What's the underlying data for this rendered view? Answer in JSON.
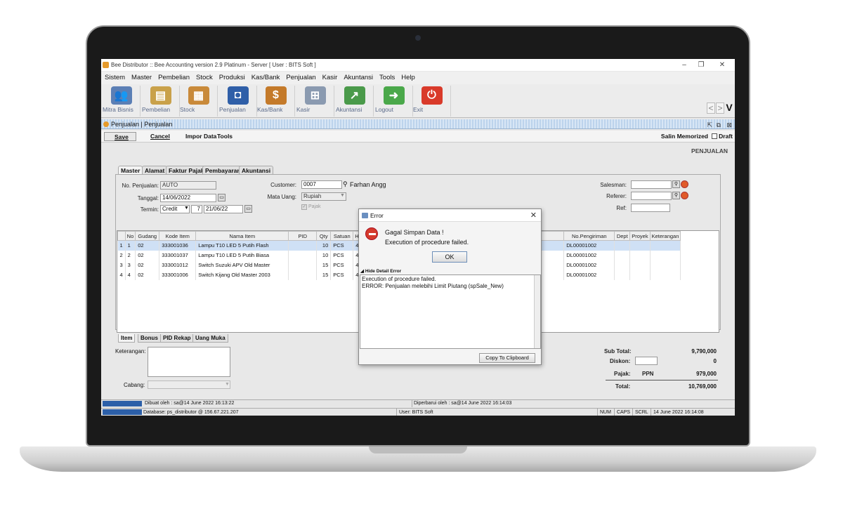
{
  "window": {
    "title": "Bee Distributor :: Bee Accounting version 2.9 Platinum - Server  [ User : BITS Soft ]",
    "minimize": "–",
    "restore": "❐",
    "close": "✕"
  },
  "menu": [
    "Sistem",
    "Master",
    "Pembelian",
    "Stock",
    "Produksi",
    "Kas/Bank",
    "Penjualan",
    "Kasir",
    "Akuntansi",
    "Tools",
    "Help"
  ],
  "toolbar": [
    {
      "label": "Mitra Bisnis",
      "icon": "users-icon",
      "color": "#5b7fb5"
    },
    {
      "label": "Pembelian",
      "icon": "documents-icon",
      "color": "#c9a14a"
    },
    {
      "label": "Stock",
      "icon": "boxes-icon",
      "color": "#c98a3a"
    },
    {
      "label": "Penjualan",
      "icon": "shopping-bag-icon",
      "color": "#2f5fa8"
    },
    {
      "label": "Kas/Bank",
      "icon": "money-bag-icon",
      "color": "#c47a2a"
    },
    {
      "label": "Kasir",
      "icon": "cart-icon",
      "color": "#8a9ab0"
    },
    {
      "label": "Akuntansi",
      "icon": "chart-icon",
      "color": "#4a9a4a"
    },
    {
      "label": "Logout",
      "icon": "logout-icon",
      "color": "#4aa84a"
    },
    {
      "label": "Exit",
      "icon": "power-icon",
      "color": "#d93a2a"
    }
  ],
  "nav": {
    "prev": "<",
    "next": ">",
    "logo": "V"
  },
  "form_title": "Penjualan | Penjualan",
  "actions": {
    "save": "Save",
    "cancel": "Cancel",
    "impor": "Impor Data",
    "tools": "Tools",
    "salin": "Salin Memorized",
    "draft": "Draft"
  },
  "heading": "PENJUALAN",
  "tabs": [
    "Master",
    "Alamat",
    "Faktur Pajak",
    "Pembayaran",
    "Akuntansi"
  ],
  "fields": {
    "no_penjualan_label": "No. Penjualan:",
    "no_penjualan": "AUTO",
    "tanggal_label": "Tanggal:",
    "tanggal": "14/06/2022",
    "termin_label": "Termin:",
    "termin": "Credit",
    "termin_days": "7",
    "termin_date": "21/06/22",
    "customer_label": "Customer:",
    "customer_code": "0007",
    "customer_name": "Farhan Angg",
    "mata_uang_label": "Mata Uang:",
    "mata_uang": "Rupiah",
    "pajak_label": "Pajak",
    "salesman_label": "Salesman:",
    "referer_label": "Referer:",
    "ref_label": "Ref:"
  },
  "grid": {
    "headers": [
      "No",
      "Gudang",
      "Kode Item",
      "Nama Item",
      "PID",
      "Qty",
      "Satuan",
      "H",
      "SO",
      "No.Pengiriman",
      "Dept",
      "Proyek",
      "Keterangan"
    ],
    "rows": [
      {
        "idx": "1",
        "no": "1",
        "gudang": "02",
        "kode": "333001036",
        "nama": "Lampu T10 LED 5 Putih Flash",
        "qty": "10",
        "satuan": "PCS",
        "h": "4",
        "pengiriman": "DL00001002"
      },
      {
        "idx": "2",
        "no": "2",
        "gudang": "02",
        "kode": "333001037",
        "nama": "Lampu T10 LED 5 Putih Biasa",
        "qty": "10",
        "satuan": "PCS",
        "h": "4",
        "pengiriman": "DL00001002"
      },
      {
        "idx": "3",
        "no": "3",
        "gudang": "02",
        "kode": "333001012",
        "nama": "Switch Suzuki APV Old Master",
        "qty": "15",
        "satuan": "PCS",
        "h": "4",
        "pengiriman": "DL00001002"
      },
      {
        "idx": "4",
        "no": "4",
        "gudang": "02",
        "kode": "333001006",
        "nama": "Switch Kijang Old Master 2003",
        "qty": "15",
        "satuan": "PCS",
        "h": "4",
        "pengiriman": "DL00001002"
      }
    ]
  },
  "bottom_tabs": [
    "Item",
    "Bonus",
    "PID Rekap",
    "Uang Muka"
  ],
  "bottom": {
    "keterangan_label": "Keterangan:",
    "cabang_label": "Cabang:"
  },
  "totals": {
    "subtotal_label": "Sub Total:",
    "subtotal": "9,790,000",
    "diskon_label": "Diskon:",
    "diskon": "0",
    "pajak_label": "Pajak:",
    "pajak_type": "PPN",
    "pajak": "979,000",
    "total_label": "Total:",
    "total": "10,769,000"
  },
  "status": {
    "dibuat": "Dibuat oleh : sa@14 June 2022  16:13:22",
    "diperbarui": "Diperbarui oleh : sa@14 June 2022  16:14:03",
    "database": "Database: ps_distributor @ 156.67.221.207",
    "user": "User: BITS Soft",
    "num": "NUM",
    "caps": "CAPS",
    "scrl": "SCRL",
    "datetime": "14 June 2022  16:14:08"
  },
  "dialog": {
    "title": "Error",
    "close": "✕",
    "heading": "Gagal Simpan Data !",
    "message": "Execution of procedure failed.",
    "ok": "OK",
    "detail_toggle": "Hide Detail Error",
    "detail_line1": "Execution of procedure failed.",
    "detail_line2": "ERROR: Penjualan melebihi Limit Piutang (spSale_New)",
    "copy": "Copy To Clipboard"
  }
}
